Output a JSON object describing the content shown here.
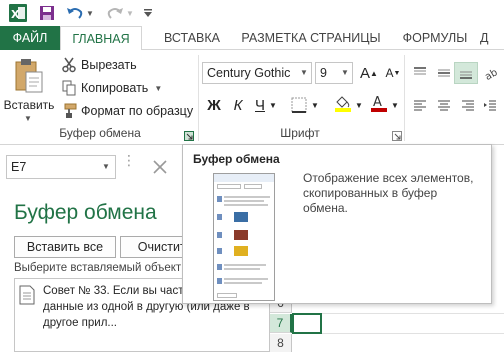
{
  "qat": {
    "app_icon": "excel-logo",
    "save_icon": "floppy-disk-icon",
    "undo_icon": "undo-arrow-icon",
    "redo_icon": "redo-arrow-icon"
  },
  "tabs": [
    {
      "label": "ФАЙЛ"
    },
    {
      "label": "ГЛАВНАЯ"
    },
    {
      "label": "ВСТАВКА"
    },
    {
      "label": "РАЗМЕТКА СТРАНИЦЫ"
    },
    {
      "label": "ФОРМУЛЫ"
    },
    {
      "label": "Д"
    }
  ],
  "clipboard_group": {
    "paste_label": "Вставить",
    "cut_label": "Вырезать",
    "copy_label": "Копировать",
    "format_painter_label": "Формат по образцу",
    "group_label": "Буфер обмена"
  },
  "font_group": {
    "font_name": "Century Gothic",
    "font_size": "9",
    "grow_label": "A",
    "shrink_label": "A",
    "bold_label": "Ж",
    "italic_label": "К",
    "underline_label": "Ч",
    "group_label": "Шрифт",
    "highlight_color": "#ffff00",
    "font_color": "#c00000"
  },
  "name_box": {
    "value": "E7"
  },
  "clipboard_pane": {
    "title": "Буфер обмена",
    "paste_all_label": "Вставить все",
    "clear_all_label": "Очистить",
    "hint": "Выберите вставляемый объект:",
    "item_text": "Совет № 33. Если вы часто копируете данные из одной в другую (или даже в другое прил..."
  },
  "rows": [
    {
      "label": "6"
    },
    {
      "label": "7"
    },
    {
      "label": "8"
    }
  ],
  "tooltip": {
    "title": "Буфер обмена",
    "description": "Отображение всех элементов, скопированных в буфер обмена."
  },
  "colors": {
    "accent": "#217346",
    "selected_bg": "#d3e8da"
  }
}
